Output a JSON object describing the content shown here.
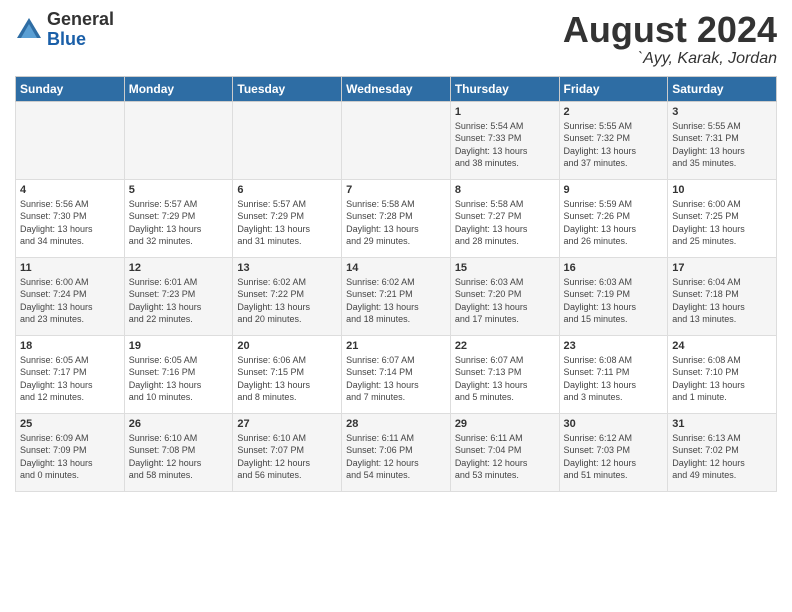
{
  "header": {
    "logo_general": "General",
    "logo_blue": "Blue",
    "month_year": "August 2024",
    "location": "`Ayy, Karak, Jordan"
  },
  "weekdays": [
    "Sunday",
    "Monday",
    "Tuesday",
    "Wednesday",
    "Thursday",
    "Friday",
    "Saturday"
  ],
  "weeks": [
    [
      {
        "day": "",
        "info": ""
      },
      {
        "day": "",
        "info": ""
      },
      {
        "day": "",
        "info": ""
      },
      {
        "day": "",
        "info": ""
      },
      {
        "day": "1",
        "info": "Sunrise: 5:54 AM\nSunset: 7:33 PM\nDaylight: 13 hours\nand 38 minutes."
      },
      {
        "day": "2",
        "info": "Sunrise: 5:55 AM\nSunset: 7:32 PM\nDaylight: 13 hours\nand 37 minutes."
      },
      {
        "day": "3",
        "info": "Sunrise: 5:55 AM\nSunset: 7:31 PM\nDaylight: 13 hours\nand 35 minutes."
      }
    ],
    [
      {
        "day": "4",
        "info": "Sunrise: 5:56 AM\nSunset: 7:30 PM\nDaylight: 13 hours\nand 34 minutes."
      },
      {
        "day": "5",
        "info": "Sunrise: 5:57 AM\nSunset: 7:29 PM\nDaylight: 13 hours\nand 32 minutes."
      },
      {
        "day": "6",
        "info": "Sunrise: 5:57 AM\nSunset: 7:29 PM\nDaylight: 13 hours\nand 31 minutes."
      },
      {
        "day": "7",
        "info": "Sunrise: 5:58 AM\nSunset: 7:28 PM\nDaylight: 13 hours\nand 29 minutes."
      },
      {
        "day": "8",
        "info": "Sunrise: 5:58 AM\nSunset: 7:27 PM\nDaylight: 13 hours\nand 28 minutes."
      },
      {
        "day": "9",
        "info": "Sunrise: 5:59 AM\nSunset: 7:26 PM\nDaylight: 13 hours\nand 26 minutes."
      },
      {
        "day": "10",
        "info": "Sunrise: 6:00 AM\nSunset: 7:25 PM\nDaylight: 13 hours\nand 25 minutes."
      }
    ],
    [
      {
        "day": "11",
        "info": "Sunrise: 6:00 AM\nSunset: 7:24 PM\nDaylight: 13 hours\nand 23 minutes."
      },
      {
        "day": "12",
        "info": "Sunrise: 6:01 AM\nSunset: 7:23 PM\nDaylight: 13 hours\nand 22 minutes."
      },
      {
        "day": "13",
        "info": "Sunrise: 6:02 AM\nSunset: 7:22 PM\nDaylight: 13 hours\nand 20 minutes."
      },
      {
        "day": "14",
        "info": "Sunrise: 6:02 AM\nSunset: 7:21 PM\nDaylight: 13 hours\nand 18 minutes."
      },
      {
        "day": "15",
        "info": "Sunrise: 6:03 AM\nSunset: 7:20 PM\nDaylight: 13 hours\nand 17 minutes."
      },
      {
        "day": "16",
        "info": "Sunrise: 6:03 AM\nSunset: 7:19 PM\nDaylight: 13 hours\nand 15 minutes."
      },
      {
        "day": "17",
        "info": "Sunrise: 6:04 AM\nSunset: 7:18 PM\nDaylight: 13 hours\nand 13 minutes."
      }
    ],
    [
      {
        "day": "18",
        "info": "Sunrise: 6:05 AM\nSunset: 7:17 PM\nDaylight: 13 hours\nand 12 minutes."
      },
      {
        "day": "19",
        "info": "Sunrise: 6:05 AM\nSunset: 7:16 PM\nDaylight: 13 hours\nand 10 minutes."
      },
      {
        "day": "20",
        "info": "Sunrise: 6:06 AM\nSunset: 7:15 PM\nDaylight: 13 hours\nand 8 minutes."
      },
      {
        "day": "21",
        "info": "Sunrise: 6:07 AM\nSunset: 7:14 PM\nDaylight: 13 hours\nand 7 minutes."
      },
      {
        "day": "22",
        "info": "Sunrise: 6:07 AM\nSunset: 7:13 PM\nDaylight: 13 hours\nand 5 minutes."
      },
      {
        "day": "23",
        "info": "Sunrise: 6:08 AM\nSunset: 7:11 PM\nDaylight: 13 hours\nand 3 minutes."
      },
      {
        "day": "24",
        "info": "Sunrise: 6:08 AM\nSunset: 7:10 PM\nDaylight: 13 hours\nand 1 minute."
      }
    ],
    [
      {
        "day": "25",
        "info": "Sunrise: 6:09 AM\nSunset: 7:09 PM\nDaylight: 13 hours\nand 0 minutes."
      },
      {
        "day": "26",
        "info": "Sunrise: 6:10 AM\nSunset: 7:08 PM\nDaylight: 12 hours\nand 58 minutes."
      },
      {
        "day": "27",
        "info": "Sunrise: 6:10 AM\nSunset: 7:07 PM\nDaylight: 12 hours\nand 56 minutes."
      },
      {
        "day": "28",
        "info": "Sunrise: 6:11 AM\nSunset: 7:06 PM\nDaylight: 12 hours\nand 54 minutes."
      },
      {
        "day": "29",
        "info": "Sunrise: 6:11 AM\nSunset: 7:04 PM\nDaylight: 12 hours\nand 53 minutes."
      },
      {
        "day": "30",
        "info": "Sunrise: 6:12 AM\nSunset: 7:03 PM\nDaylight: 12 hours\nand 51 minutes."
      },
      {
        "day": "31",
        "info": "Sunrise: 6:13 AM\nSunset: 7:02 PM\nDaylight: 12 hours\nand 49 minutes."
      }
    ]
  ]
}
